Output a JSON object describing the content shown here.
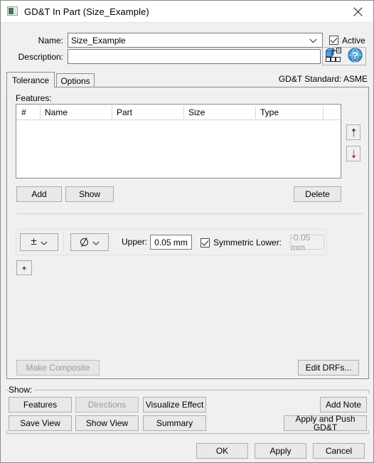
{
  "window": {
    "title": "GD&T In Part (Size_Example)",
    "icon": "app-icon",
    "close_label": "✕"
  },
  "header": {
    "name_label": "Name:",
    "name_value": "Size_Example",
    "description_label": "Description:",
    "description_value": "",
    "description_placeholder": "",
    "active_label": "Active",
    "active_checked": true,
    "icons": [
      "gdt-matrix-icon",
      "help-globe-icon"
    ]
  },
  "tabs": {
    "items": [
      {
        "label": "Tolerance",
        "active": true
      },
      {
        "label": "Options",
        "active": false
      }
    ],
    "standard_text": "GD&T Standard: ASME"
  },
  "features": {
    "label": "Features:",
    "columns": [
      "#",
      "Name",
      "Part",
      "Size",
      "Type",
      ""
    ],
    "rows": [],
    "move_up_label": "↑",
    "move_down_label": "↓",
    "add_label": "Add",
    "show_label": "Show",
    "delete_label": "Delete"
  },
  "tolerance": {
    "type_symbol": "±",
    "type_symbol_name": "plus-minus-symbol",
    "modifier_symbol": "⌀",
    "modifier_symbol_name": "diameter-symbol",
    "upper_label": "Upper:",
    "upper_value": "0.05 mm",
    "symmetric_label": "Symmetric Lower:",
    "symmetric_checked": true,
    "lower_value": "-0.05 mm",
    "lower_disabled": true,
    "add_row_label": "+"
  },
  "composite": {
    "make_composite_label": "Make Composite",
    "make_composite_disabled": true,
    "edit_drfs_label": "Edit DRFs..."
  },
  "show_group": {
    "label": "Show:",
    "buttons": [
      {
        "label": "Features",
        "disabled": false
      },
      {
        "label": "Directions",
        "disabled": true
      },
      {
        "label": "Visualize Effect",
        "disabled": false
      },
      {
        "label": "Add Note",
        "disabled": false
      },
      {
        "label": "Save View",
        "disabled": false
      },
      {
        "label": "Show View",
        "disabled": false
      },
      {
        "label": "Summary",
        "disabled": false
      },
      {
        "label": "Apply and Push GD&T",
        "disabled": false
      }
    ]
  },
  "footer": {
    "ok_label": "OK",
    "apply_label": "Apply",
    "cancel_label": "Cancel"
  },
  "colors": {
    "window_bg": "#f0f0f0",
    "titlebar_bg": "#ffffff",
    "border": "#8d8d8d",
    "button_bg": "#e9e9e9",
    "disabled_text": "#9a9a9a",
    "icon_blue": "#2e6fc4"
  }
}
